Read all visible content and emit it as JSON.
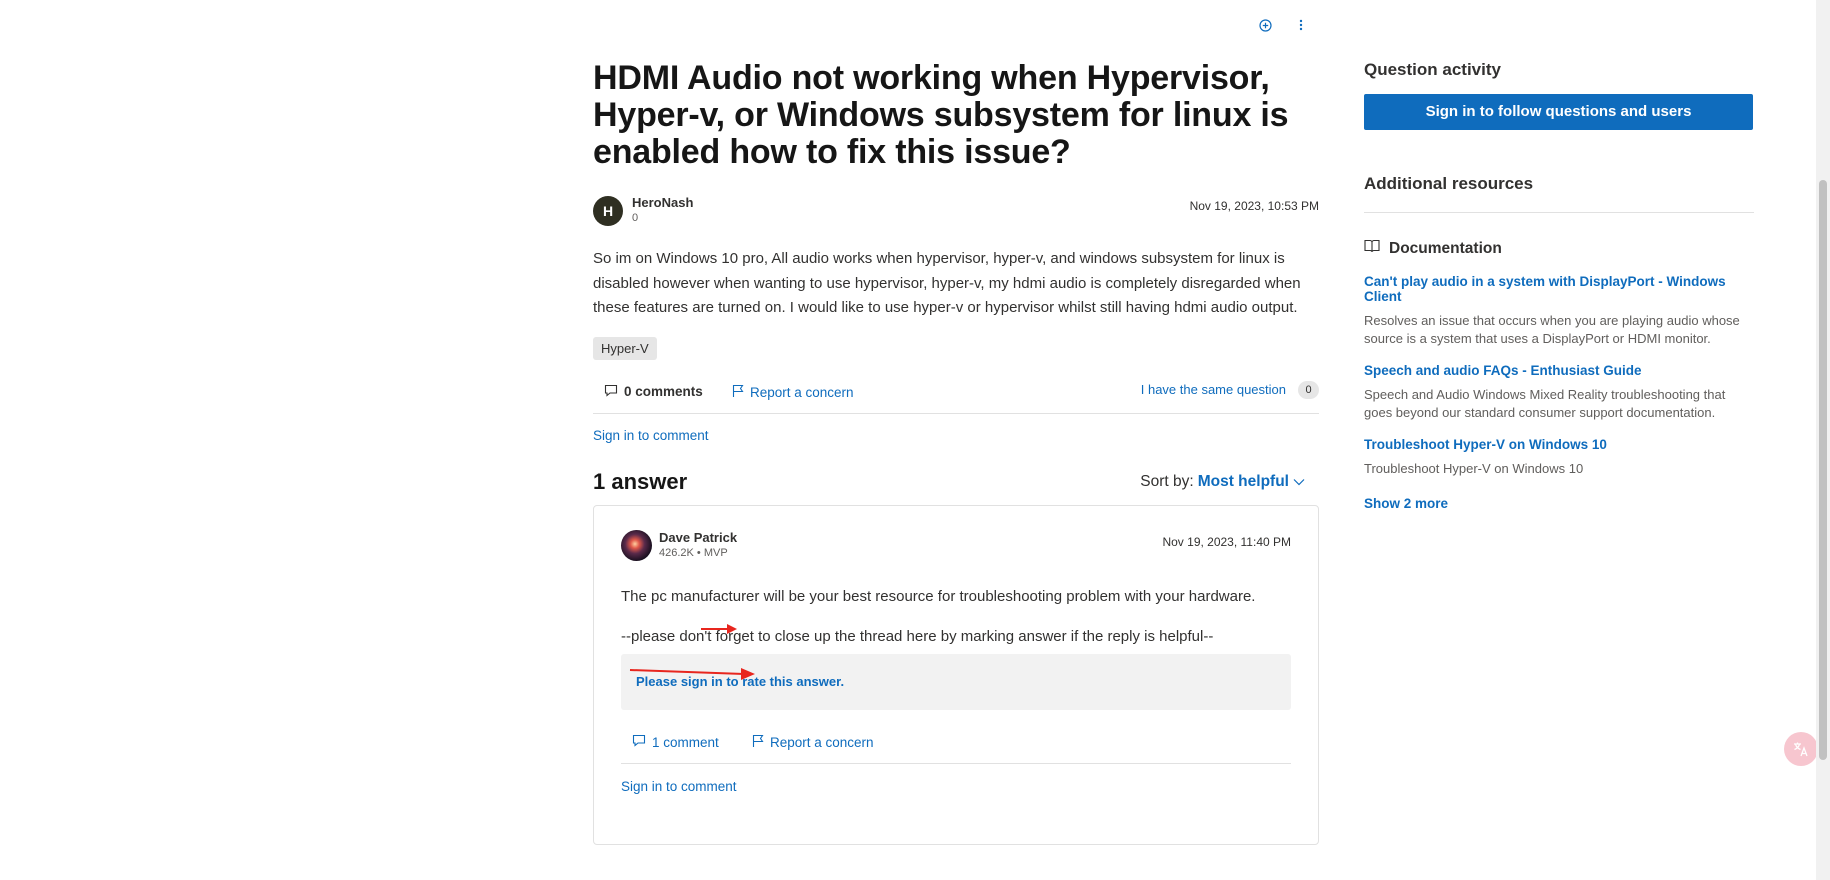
{
  "question": {
    "title": "HDMI Audio not working when Hypervisor, Hyper-v, or Windows subsystem for linux is enabled how to fix this issue?",
    "author": {
      "initial": "H",
      "name": "HeroNash",
      "reputation": "0"
    },
    "date": "Nov 19, 2023, 10:53 PM",
    "body": "So im on Windows 10 pro, All audio works when hypervisor, hyper-v, and windows subsystem for linux is disabled however when wanting to use hypervisor, hyper-v, my hdmi audio is completely disregarded when these features are turned on. I would like to use hyper-v or hypervisor whilst still having hdmi audio output.",
    "tag": "Hyper-V",
    "comments_label": "0 comments",
    "report_label": "Report a concern",
    "same_question_label": "I have the same question",
    "same_question_count": "0",
    "sign_in_comment": "Sign in to comment"
  },
  "answers": {
    "count_label": "1 answer",
    "sort_label": "Sort by:",
    "sort_value": "Most helpful",
    "items": [
      {
        "author": {
          "name": "Dave Patrick",
          "reputation": "426.2K • MVP"
        },
        "date": "Nov 19, 2023, 11:40 PM",
        "paragraph1": "The pc manufacturer will be your best resource for troubleshooting problem with your hardware.",
        "paragraph2": "--please don't forget to close up the thread here by marking answer if the reply is helpful--",
        "rate_prompt": "Please sign in to rate this answer.",
        "comments_label": "1 comment",
        "report_label": "Report a concern",
        "sign_in_comment": "Sign in to comment"
      }
    ]
  },
  "sidebar": {
    "activity_title": "Question activity",
    "signin_button": "Sign in to follow questions and users",
    "resources_title": "Additional resources",
    "doc_heading": "Documentation",
    "docs": [
      {
        "title": "Can't play audio in a system with DisplayPort - Windows Client",
        "desc": "Resolves an issue that occurs when you are playing audio whose source is a system that uses a DisplayPort or HDMI monitor."
      },
      {
        "title": "Speech and audio FAQs - Enthusiast Guide",
        "desc": "Speech and Audio Windows Mixed Reality troubleshooting that goes beyond our standard consumer support documentation."
      },
      {
        "title": "Troubleshoot Hyper-V on Windows 10",
        "desc": "Troubleshoot Hyper-V on Windows 10"
      }
    ],
    "show_more": "Show 2 more"
  },
  "icons": {
    "top": [
      "add-circle-icon",
      "more-vertical-icon"
    ],
    "comment": "comment-icon",
    "flag": "flag-icon",
    "book": "book-icon",
    "translate": "translate-icon"
  },
  "colors": {
    "link": "#0f6cbd",
    "primary_button": "#0f6cbd",
    "annotation_arrow": "#e8261e"
  }
}
